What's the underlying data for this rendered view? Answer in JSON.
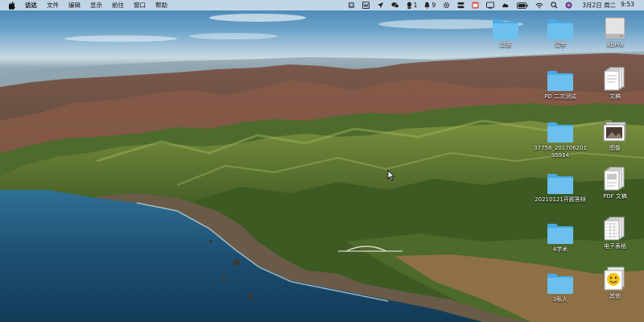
{
  "menubar": {
    "apple_icon": "apple-logo",
    "items": [
      "访达",
      "文件",
      "编辑",
      "显示",
      "前往",
      "窗口",
      "帮助"
    ],
    "status": {
      "qq_badge": "1",
      "notification_count": "9",
      "date": "3月2日 周二",
      "time": "9:53"
    }
  },
  "desktop": {
    "icons": [
      {
        "label": "口语",
        "type": "folder"
      },
      {
        "label": "留学",
        "type": "folder"
      },
      {
        "label": "XDPro",
        "type": "drive"
      },
      {
        "label": "PD 二次测试",
        "type": "folder"
      },
      {
        "label": "文稿",
        "type": "document-stack"
      },
      {
        "label": "37758_20170620195914",
        "type": "folder"
      },
      {
        "label": "图像",
        "type": "image-stack"
      },
      {
        "label": "20210121开题答辩",
        "type": "folder"
      },
      {
        "label": "PDF 文稿",
        "type": "pdf-stack"
      },
      {
        "label": "4学术",
        "type": "folder"
      },
      {
        "label": "电子表格",
        "type": "spreadsheet-stack"
      },
      {
        "label": "3私人",
        "type": "folder"
      },
      {
        "label": "其他",
        "type": "other-stack"
      }
    ]
  },
  "colors": {
    "folder": "#6cc0ee",
    "folder_tab": "#4aa9e3",
    "menubar": "#e4ecf4"
  }
}
